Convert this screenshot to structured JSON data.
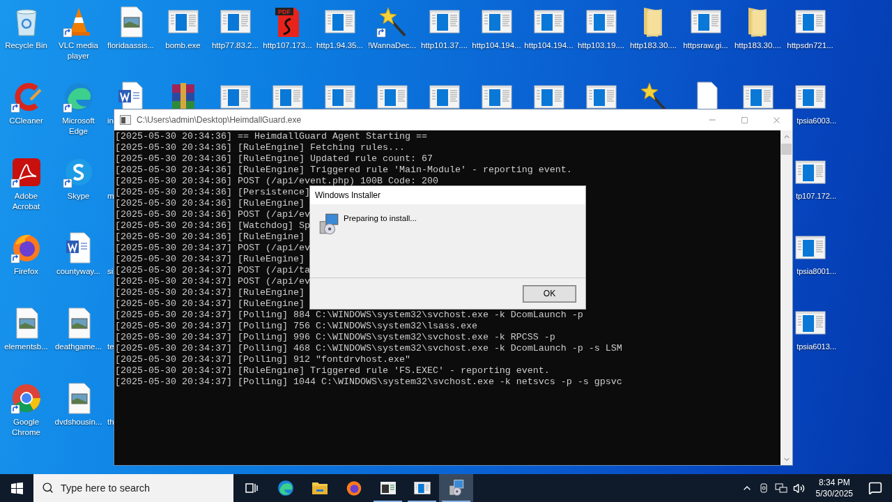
{
  "desktop": {
    "columns": [
      [
        {
          "kind": "recycle",
          "label": "Recycle Bin"
        },
        {
          "kind": "ccleaner",
          "label": "CCleaner",
          "shortcut": true
        },
        {
          "kind": "acrobat",
          "label": "Adobe Acrobat",
          "shortcut": true
        },
        {
          "kind": "firefox",
          "label": "Firefox",
          "shortcut": true
        },
        {
          "kind": "image",
          "label": "elementsb..."
        },
        {
          "kind": "chrome",
          "label": "Google Chrome",
          "shortcut": true
        }
      ],
      [
        {
          "kind": "vlc",
          "label": "VLC media player",
          "shortcut": true
        },
        {
          "kind": "edge",
          "label": "Microsoft Edge",
          "shortcut": true
        },
        {
          "kind": "skype",
          "label": "Skype",
          "shortcut": true
        },
        {
          "kind": "word",
          "label": "countyway..."
        },
        {
          "kind": "image",
          "label": "deathgame..."
        },
        {
          "kind": "image",
          "label": "dvdshousin..."
        }
      ],
      [
        {
          "kind": "image",
          "label": "floridaassis..."
        },
        {
          "kind": "word",
          "label": "in"
        },
        {
          "label": "m"
        },
        {
          "label": "si"
        },
        {
          "label": "te"
        },
        {
          "label": "th"
        }
      ],
      [
        {
          "kind": "app",
          "label": "bomb.exe"
        },
        {
          "kind": "archive"
        }
      ],
      [
        {
          "kind": "app",
          "label": "http77.83.2..."
        },
        {
          "kind": "app"
        }
      ],
      [
        {
          "kind": "pdf",
          "icon_text": "PDF",
          "label": "http107.173..."
        },
        {
          "kind": "app"
        }
      ],
      [
        {
          "kind": "app",
          "label": "http1.94.35..."
        },
        {
          "kind": "app"
        }
      ],
      [
        {
          "kind": "wand",
          "label": "!WannaDec...",
          "shortcut": true
        },
        {
          "kind": "app"
        }
      ],
      [
        {
          "kind": "app",
          "label": "http101.37...."
        },
        {
          "kind": "app"
        }
      ],
      [
        {
          "kind": "app",
          "label": "http104.194..."
        },
        {
          "kind": "app"
        }
      ],
      [
        {
          "kind": "app",
          "label": "http104.194..."
        },
        {
          "kind": "app"
        }
      ],
      [
        {
          "kind": "app",
          "label": "http103.19...."
        },
        {
          "kind": "app"
        }
      ],
      [
        {
          "kind": "folder",
          "label": "http183.30...."
        },
        {
          "kind": "wand"
        }
      ],
      [
        {
          "kind": "app",
          "label": "httpsraw.gi..."
        },
        {
          "kind": "blank"
        }
      ],
      [
        {
          "kind": "folder",
          "label": "http183.30...."
        },
        {
          "kind": "app"
        }
      ],
      [
        {
          "kind": "app",
          "label": "httpsdn721..."
        },
        {
          "kind": "app",
          "label": "tpsia6003..."
        },
        {
          "kind": "app",
          "label": "tp107.172..."
        },
        {
          "kind": "app",
          "label": "tpsia8001..."
        },
        {
          "kind": "app",
          "label": "tpsia6013..."
        }
      ]
    ]
  },
  "console": {
    "title": "C:\\Users\\admin\\Desktop\\HeimdallGuard.exe",
    "lines": [
      "[2025-05-30 20:34:36] == HeimdallGuard Agent Starting ==",
      "[2025-05-30 20:34:36] [RuleEngine] Fetching rules...",
      "[2025-05-30 20:34:36] [RuleEngine] Updated rule count: 67",
      "[2025-05-30 20:34:36] [RuleEngine] Triggered rule 'Main-Module' - reporting event.",
      "[2025-05-30 20:34:36] POST (/api/event.php) 100B Code: 200",
      "[2025-05-30 20:34:36] [Persistence]",
      "[2025-05-30 20:34:36] [RuleEngine]",
      "[2025-05-30 20:34:36] POST (/api/ev",
      "[2025-05-30 20:34:36] [Watchdog] Sp",
      "[2025-05-30 20:34:36] [RuleEngine]",
      "[2025-05-30 20:34:37] POST (/api/ev",
      "[2025-05-30 20:34:37] [RuleEngine]",
      "[2025-05-30 20:34:37] POST (/api/ta",
      "[2025-05-30 20:34:37] POST (/api/ev",
      "[2025-05-30 20:34:37] [RuleEngine]",
      "[2025-05-30 20:34:37] [RuleEngine]",
      "[2025-05-30 20:34:37] [Polling] 884 C:\\WINDOWS\\system32\\svchost.exe -k DcomLaunch -p",
      "[2025-05-30 20:34:37] [Polling] 756 C:\\WINDOWS\\system32\\lsass.exe",
      "[2025-05-30 20:34:37] [Polling] 996 C:\\WINDOWS\\system32\\svchost.exe -k RPCSS -p",
      "[2025-05-30 20:34:37] [Polling] 468 C:\\WINDOWS\\system32\\svchost.exe -k DcomLaunch -p -s LSM",
      "[2025-05-30 20:34:37] [Polling] 912 \"fontdrvhost.exe\"",
      "[2025-05-30 20:34:37] [RuleEngine] Triggered rule 'FS.EXEC' - reporting event.",
      "[2025-05-30 20:34:37] [Polling] 1044 C:\\WINDOWS\\system32\\svchost.exe -k netsvcs -p -s gpsvc"
    ]
  },
  "dialog": {
    "title": "Windows Installer",
    "message": "Preparing to install...",
    "button": "OK"
  },
  "taskbar": {
    "search": {
      "placeholder": "Type here to search"
    },
    "apps": [
      {
        "kind": "taskview",
        "running": false,
        "selected": false
      },
      {
        "kind": "edge",
        "running": false,
        "selected": false
      },
      {
        "kind": "explorer",
        "running": false,
        "selected": false
      },
      {
        "kind": "firefox",
        "running": false,
        "selected": false
      },
      {
        "kind": "console",
        "running": true,
        "selected": false
      },
      {
        "kind": "app",
        "running": true,
        "selected": false
      },
      {
        "kind": "installer",
        "running": true,
        "selected": true
      }
    ],
    "time": "8:34 PM",
    "date": "5/30/2025"
  }
}
